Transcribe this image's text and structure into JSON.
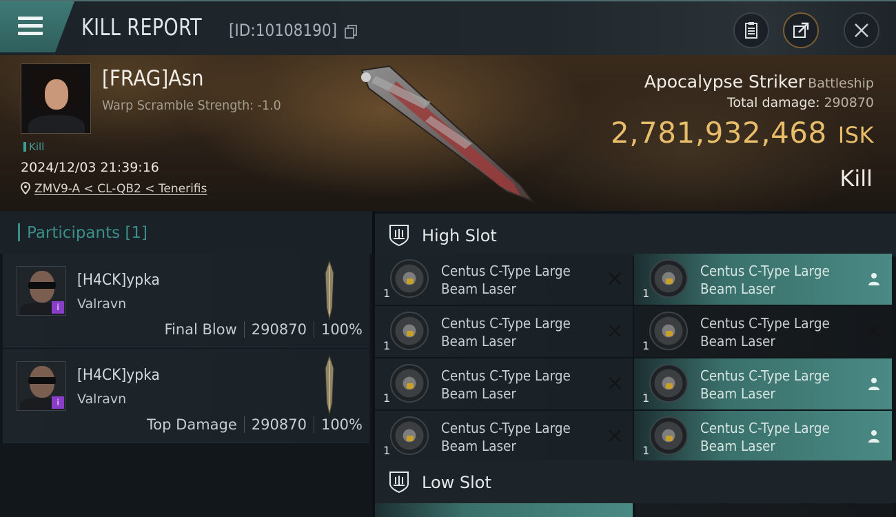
{
  "header": {
    "title": "KILL REPORT",
    "report_id": "[ID:10108190]"
  },
  "victim": {
    "name": "[FRAG]Asn",
    "warp_scramble": "Warp Scramble Strength: -1.0",
    "tag": "Kill",
    "date": "2024/12/03 21:39:16",
    "location": "ZMV9-A < CL-QB2 < Tenerifis",
    "ship_name": "Apocalypse Striker",
    "ship_class": "Battleship",
    "total_damage_label": "Total damage:",
    "total_damage": "290870",
    "isk_value": "2,781,932,468",
    "isk_unit": "ISK",
    "result": "Kill"
  },
  "participants": {
    "title": "Participants",
    "count": "[1]",
    "rows": [
      {
        "name": "[H4CK]ypka",
        "ship": "Valravn",
        "role": "Final Blow",
        "damage": "290870",
        "percent": "100%"
      },
      {
        "name": "[H4CK]ypka",
        "ship": "Valravn",
        "role": "Top Damage",
        "damage": "290870",
        "percent": "100%"
      }
    ]
  },
  "slots": {
    "high": {
      "label": "High Slot",
      "items": [
        {
          "name": "Centus C-Type Large Beam Laser",
          "qty": "1",
          "state": "destroyed"
        },
        {
          "name": "Centus C-Type Large Beam Laser",
          "qty": "1",
          "state": "dropped"
        },
        {
          "name": "Centus C-Type Large Beam Laser",
          "qty": "1",
          "state": "destroyed"
        },
        {
          "name": "Centus C-Type Large Beam Laser",
          "qty": "1",
          "state": "destroyed"
        },
        {
          "name": "Centus C-Type Large Beam Laser",
          "qty": "1",
          "state": "destroyed"
        },
        {
          "name": "Centus C-Type Large Beam Laser",
          "qty": "1",
          "state": "dropped"
        },
        {
          "name": "Centus C-Type Large Beam Laser",
          "qty": "1",
          "state": "destroyed"
        },
        {
          "name": "Centus C-Type Large Beam Laser",
          "qty": "1",
          "state": "dropped"
        }
      ]
    },
    "low": {
      "label": "Low Slot"
    }
  },
  "colors": {
    "accent_teal": "#3b8f8b",
    "isk_gold": "#e8bd6a",
    "dropped_teal": "#4a8a84"
  }
}
